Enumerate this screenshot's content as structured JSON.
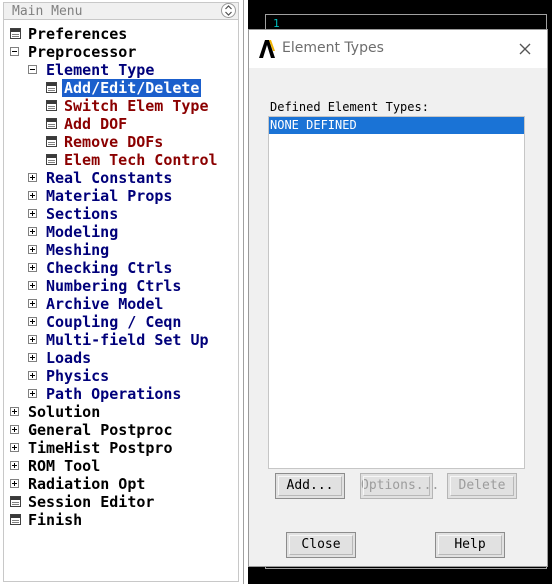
{
  "main_menu": {
    "title": "Main Menu",
    "items": [
      {
        "label": "Preferences",
        "icon": "window-icon",
        "level": 0,
        "color": "black"
      },
      {
        "label": "Preprocessor",
        "icon": "collapse-icon",
        "level": 0,
        "color": "black"
      },
      {
        "label": "Element Type",
        "icon": "collapse-icon",
        "level": 1,
        "color": "navy"
      },
      {
        "label": "Add/Edit/Delete",
        "icon": "window-icon",
        "level": 2,
        "color": "highlight",
        "selected": true
      },
      {
        "label": "Switch Elem Type",
        "icon": "window-icon",
        "level": 2,
        "color": "red"
      },
      {
        "label": "Add DOF",
        "icon": "window-icon",
        "level": 2,
        "color": "red"
      },
      {
        "label": "Remove DOFs",
        "icon": "window-icon",
        "level": 2,
        "color": "red"
      },
      {
        "label": "Elem Tech Control",
        "icon": "window-icon",
        "level": 2,
        "color": "red"
      },
      {
        "label": "Real Constants",
        "icon": "expand-icon",
        "level": 1,
        "color": "navy"
      },
      {
        "label": "Material Props",
        "icon": "expand-icon",
        "level": 1,
        "color": "navy"
      },
      {
        "label": "Sections",
        "icon": "expand-icon",
        "level": 1,
        "color": "navy"
      },
      {
        "label": "Modeling",
        "icon": "expand-icon",
        "level": 1,
        "color": "navy"
      },
      {
        "label": "Meshing",
        "icon": "expand-icon",
        "level": 1,
        "color": "navy"
      },
      {
        "label": "Checking Ctrls",
        "icon": "expand-icon",
        "level": 1,
        "color": "navy"
      },
      {
        "label": "Numbering Ctrls",
        "icon": "expand-icon",
        "level": 1,
        "color": "navy"
      },
      {
        "label": "Archive Model",
        "icon": "expand-icon",
        "level": 1,
        "color": "navy"
      },
      {
        "label": "Coupling / Ceqn",
        "icon": "expand-icon",
        "level": 1,
        "color": "navy"
      },
      {
        "label": "Multi-field Set Up",
        "icon": "expand-icon",
        "level": 1,
        "color": "navy"
      },
      {
        "label": "Loads",
        "icon": "expand-icon",
        "level": 1,
        "color": "navy"
      },
      {
        "label": "Physics",
        "icon": "expand-icon",
        "level": 1,
        "color": "navy"
      },
      {
        "label": "Path Operations",
        "icon": "expand-icon",
        "level": 1,
        "color": "navy"
      },
      {
        "label": "Solution",
        "icon": "expand-icon",
        "level": 0,
        "color": "black"
      },
      {
        "label": "General Postproc",
        "icon": "expand-icon",
        "level": 0,
        "color": "black"
      },
      {
        "label": "TimeHist Postpro",
        "icon": "expand-icon",
        "level": 0,
        "color": "black"
      },
      {
        "label": "ROM Tool",
        "icon": "expand-icon",
        "level": 0,
        "color": "black"
      },
      {
        "label": "Radiation Opt",
        "icon": "expand-icon",
        "level": 0,
        "color": "black"
      },
      {
        "label": "Session Editor",
        "icon": "window-icon",
        "level": 0,
        "color": "black"
      },
      {
        "label": "Finish",
        "icon": "window-icon",
        "level": 0,
        "color": "black"
      }
    ]
  },
  "graphics": {
    "window_number": "1"
  },
  "dialog": {
    "title": "Element Types",
    "defined_label": "Defined Element Types:",
    "list_items": [
      "NONE DEFINED"
    ],
    "buttons": {
      "add": "Add...",
      "options": "Options...",
      "delete": "Delete",
      "close": "Close",
      "help": "Help"
    }
  },
  "colors": {
    "selection": "#1b5fcc",
    "list_selection": "#1a73d6",
    "menu_black": "#000000",
    "menu_navy": "#00007a",
    "menu_red": "#8b0000"
  }
}
